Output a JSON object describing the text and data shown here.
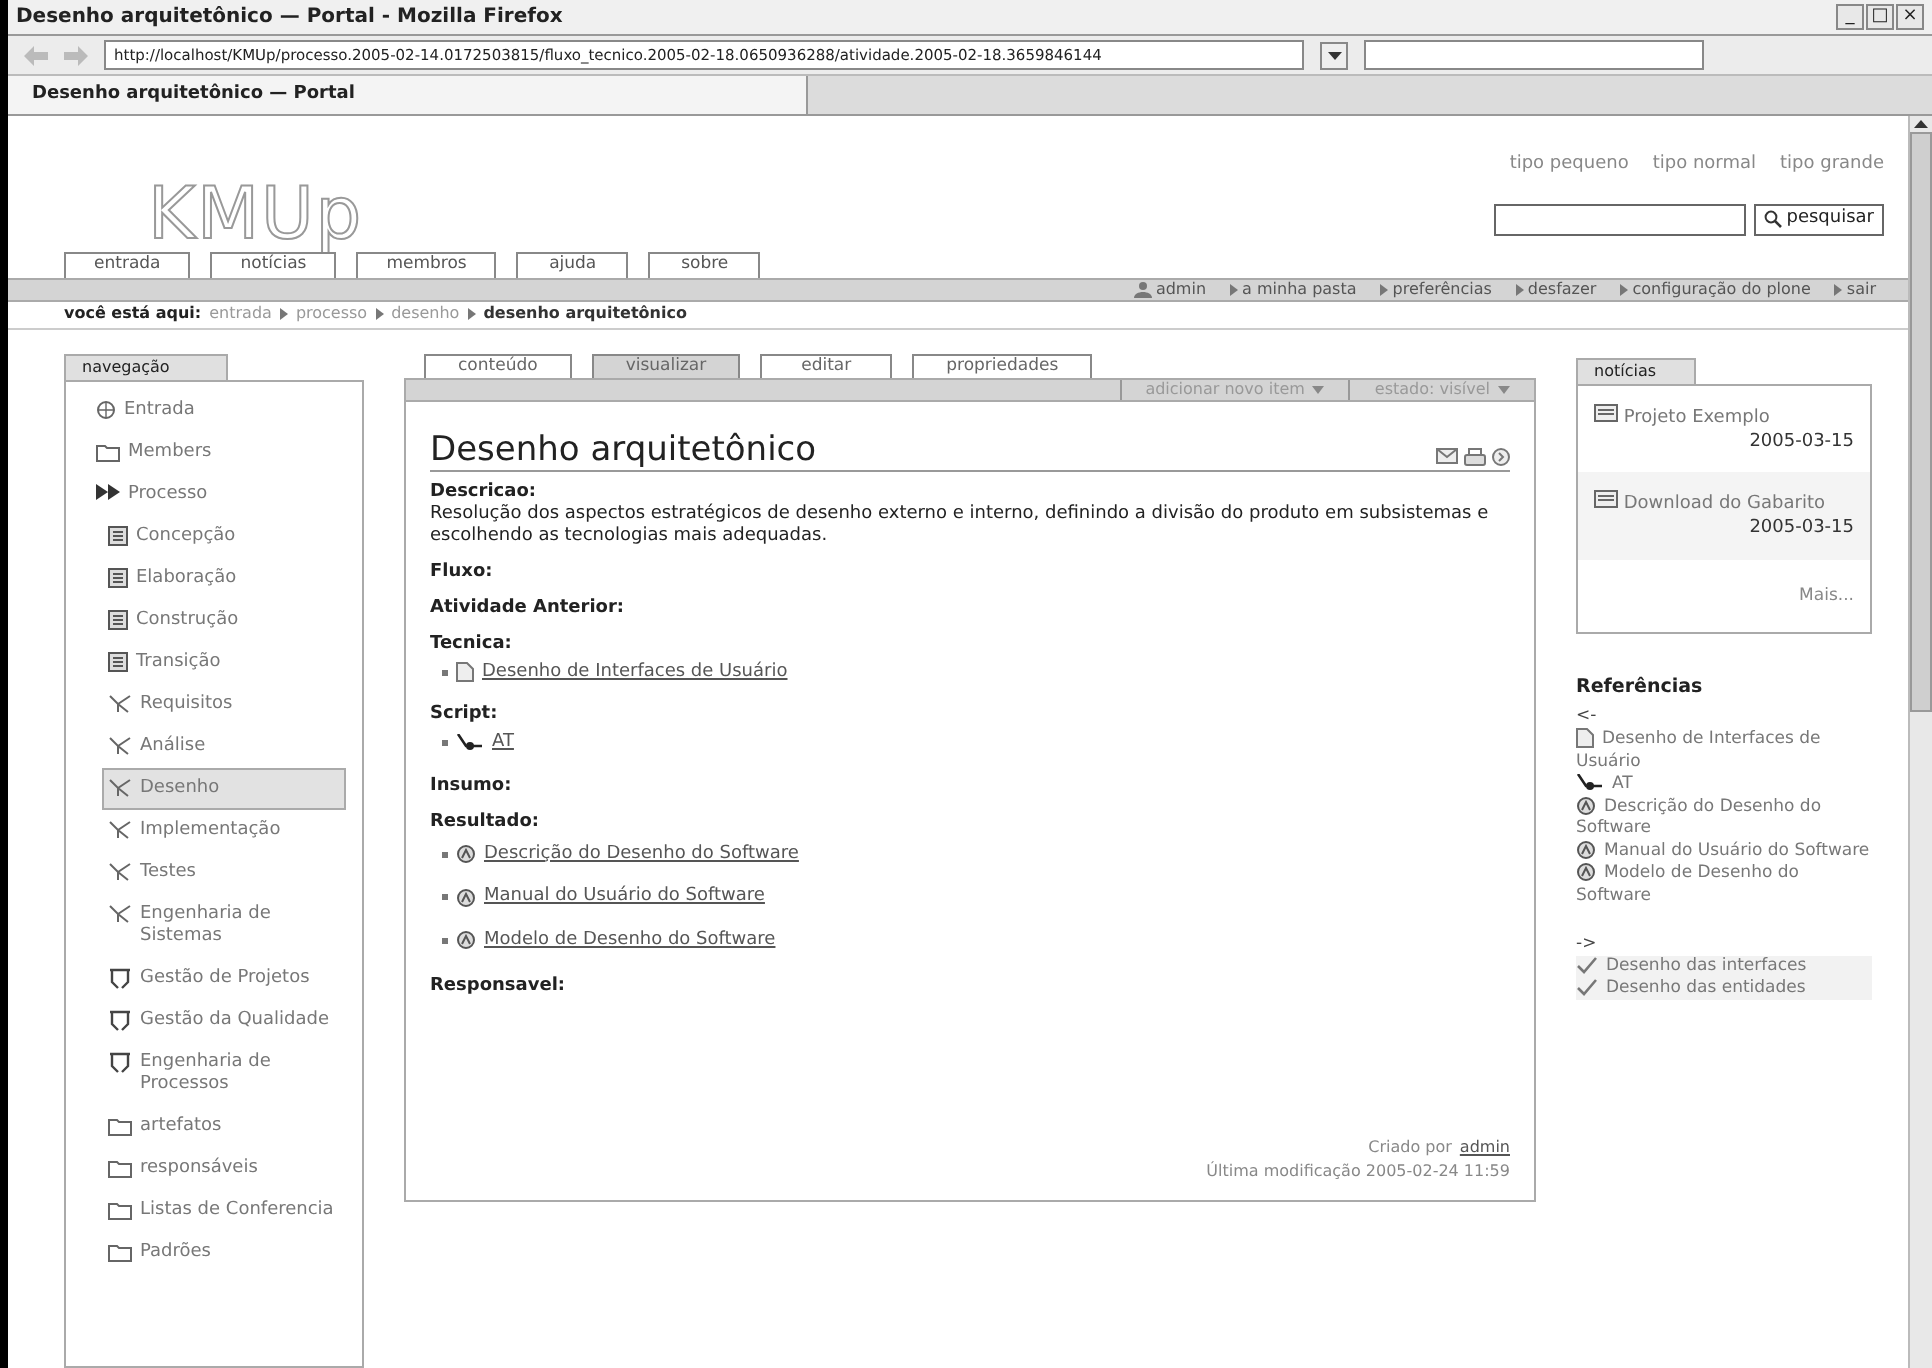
{
  "window": {
    "title": "Desenho arquitetônico — Portal - Mozilla Firefox",
    "controls": [
      "_",
      "□",
      "×"
    ]
  },
  "navbar": {
    "address": "http://localhost/KMUp/processo.2005-02-14.0172503815/fluxo_tecnico.2005-02-18.0650936288/atividade.2005-02-18.3659846144"
  },
  "browser_tabs": [
    {
      "label": "Desenho arquitetônico — Portal",
      "selected": true
    }
  ],
  "font_size_links": [
    "tipo pequeno",
    "tipo normal",
    "tipo grande"
  ],
  "logo": "KMUp",
  "search": {
    "button": "pesquisar"
  },
  "site_tabs": [
    "entrada",
    "notícias",
    "membros",
    "ajuda",
    "sobre"
  ],
  "personal_bar": [
    {
      "label": "admin",
      "kind": "user"
    },
    {
      "label": "a minha pasta",
      "kind": "link"
    },
    {
      "label": "preferências",
      "kind": "link"
    },
    {
      "label": "desfazer",
      "kind": "link"
    },
    {
      "label": "configuração do plone",
      "kind": "link"
    },
    {
      "label": "sair",
      "kind": "link"
    }
  ],
  "breadcrumb": {
    "label": "você está aqui:",
    "items": [
      {
        "label": "entrada",
        "current": false
      },
      {
        "label": "processo",
        "current": false
      },
      {
        "label": "desenho",
        "current": false
      },
      {
        "label": "desenho arquitetônico",
        "current": true
      }
    ]
  },
  "navigation": {
    "title": "navegação",
    "items": [
      {
        "label": "Entrada",
        "kind": "globe",
        "selected": false
      },
      {
        "label": "Members",
        "kind": "folder",
        "selected": false
      },
      {
        "label": "Processo",
        "kind": "arrow",
        "selected": false,
        "children": [
          {
            "label": "Concepção",
            "kind": "phase",
            "selected": false
          },
          {
            "label": "Elaboração",
            "kind": "phase",
            "selected": false
          },
          {
            "label": "Construção",
            "kind": "phase",
            "selected": false
          },
          {
            "label": "Transição",
            "kind": "phase",
            "selected": false
          },
          {
            "label": "Requisitos",
            "kind": "flow",
            "selected": false
          },
          {
            "label": "Análise",
            "kind": "flow",
            "selected": false
          },
          {
            "label": "Desenho",
            "kind": "flow",
            "selected": true
          },
          {
            "label": "Implementação",
            "kind": "flow",
            "selected": false
          },
          {
            "label": "Testes",
            "kind": "flow",
            "selected": false
          },
          {
            "label": "Engenharia de Sistemas",
            "kind": "flow",
            "selected": false
          },
          {
            "label": "Gestão de Projetos",
            "kind": "support",
            "selected": false
          },
          {
            "label": "Gestão da Qualidade",
            "kind": "support",
            "selected": false
          },
          {
            "label": "Engenharia de Processos",
            "kind": "support",
            "selected": false
          },
          {
            "label": "artefatos",
            "kind": "folder",
            "selected": false
          },
          {
            "label": "responsáveis",
            "kind": "folder",
            "selected": false
          },
          {
            "label": "Listas de Conferencia",
            "kind": "folder",
            "selected": false
          },
          {
            "label": "Padrões",
            "kind": "folder",
            "selected": false
          }
        ]
      }
    ]
  },
  "content_tabs": [
    {
      "label": "conteúdo",
      "selected": false
    },
    {
      "label": "visualizar",
      "selected": true
    },
    {
      "label": "editar",
      "selected": false
    },
    {
      "label": "propriedades",
      "selected": false
    }
  ],
  "content_actions": [
    {
      "label": "adicionar novo item",
      "disabled": true
    },
    {
      "label": "estado: visível",
      "disabled": true
    }
  ],
  "document": {
    "title": "Desenho arquitetônico",
    "sections": [
      {
        "heading": "Descricao:",
        "text": "Resolução dos aspectos estratégicos de desenho externo e interno, definindo a divisão do produto em subsistemas e escolhendo as tecnologias mais adequadas."
      },
      {
        "heading": "Fluxo:"
      },
      {
        "heading": "Atividade Anterior:"
      },
      {
        "heading": "Tecnica:",
        "links": [
          {
            "label": "Desenho de Interfaces de Usuário",
            "kind": "page"
          }
        ]
      },
      {
        "heading": "Script:",
        "links": [
          {
            "label": "AT",
            "kind": "script"
          }
        ]
      },
      {
        "heading": "Insumo:"
      },
      {
        "heading": "Resultado:",
        "links": [
          {
            "label": "Descrição do Desenho do Software",
            "kind": "artifact"
          },
          {
            "label": "Manual do Usuário do Software",
            "kind": "artifact"
          },
          {
            "label": "Modelo de Desenho do Software",
            "kind": "artifact"
          }
        ]
      },
      {
        "heading": "Responsavel:"
      }
    ],
    "created_by_label": "Criado por",
    "created_by": "admin",
    "modified": "Última modificação 2005-02-24 11:59"
  },
  "news": {
    "title": "notícias",
    "items": [
      {
        "title": "Projeto Exemplo",
        "date": "2005-03-15"
      },
      {
        "title": "Download do Gabarito",
        "date": "2005-03-15"
      }
    ],
    "more": "Mais..."
  },
  "references": {
    "title": "Referências",
    "groups": [
      {
        "label": "<-",
        "items": [
          {
            "label": "Desenho de Interfaces de Usuário",
            "kind": "page"
          },
          {
            "label": "AT",
            "kind": "script"
          },
          {
            "label": "Descrição do Desenho do Software",
            "kind": "artifact"
          },
          {
            "label": "Manual do Usuário do Software",
            "kind": "artifact"
          },
          {
            "label": "Modelo de Desenho do Software",
            "kind": "artifact"
          }
        ]
      },
      {
        "label": "->",
        "items": [
          {
            "label": "Desenho das interfaces",
            "kind": "check"
          },
          {
            "label": "Desenho das entidades",
            "kind": "check"
          }
        ]
      }
    ]
  }
}
